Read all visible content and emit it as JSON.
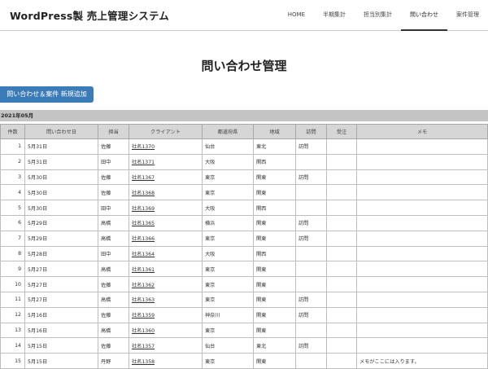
{
  "site_title": "WordPress製 売上管理システム",
  "nav": [
    {
      "label": "HOME"
    },
    {
      "label": "半期集計"
    },
    {
      "label": "担当別集計"
    },
    {
      "label": "問い合わせ"
    },
    {
      "label": "案件管理"
    }
  ],
  "page_title": "問い合わせ管理",
  "add_button_label": "問い合わせ＆案件 新規追加",
  "month_label": "2021年05月",
  "table": {
    "headers": [
      "件数",
      "問い合わせ日",
      "担当",
      "クライアント",
      "都道府県",
      "地域",
      "訪問",
      "受注",
      "メモ"
    ],
    "rows": [
      [
        "1",
        "5月31日",
        "佐藤",
        "社名1370",
        "仙台",
        "東北",
        "訪問",
        "",
        ""
      ],
      [
        "2",
        "5月31日",
        "田中",
        "社名1371",
        "大阪",
        "関西",
        "",
        "",
        ""
      ],
      [
        "3",
        "5月30日",
        "佐藤",
        "社名1367",
        "東京",
        "関東",
        "訪問",
        "",
        ""
      ],
      [
        "4",
        "5月30日",
        "佐藤",
        "社名1368",
        "東京",
        "関東",
        "",
        "",
        ""
      ],
      [
        "5",
        "5月30日",
        "田中",
        "社名1369",
        "大阪",
        "関西",
        "",
        "",
        ""
      ],
      [
        "6",
        "5月29日",
        "高橋",
        "社名1365",
        "横浜",
        "関東",
        "訪問",
        "",
        ""
      ],
      [
        "7",
        "5月29日",
        "高橋",
        "社名1366",
        "東京",
        "関東",
        "訪問",
        "",
        ""
      ],
      [
        "8",
        "5月28日",
        "田中",
        "社名1364",
        "大阪",
        "関西",
        "",
        "",
        ""
      ],
      [
        "9",
        "5月27日",
        "高橋",
        "社名1361",
        "東京",
        "関東",
        "",
        "",
        ""
      ],
      [
        "10",
        "5月27日",
        "佐藤",
        "社名1362",
        "東京",
        "関東",
        "",
        "",
        ""
      ],
      [
        "11",
        "5月27日",
        "高橋",
        "社名1363",
        "東京",
        "関東",
        "訪問",
        "",
        ""
      ],
      [
        "12",
        "5月16日",
        "佐藤",
        "社名1359",
        "神奈川",
        "関東",
        "訪問",
        "",
        ""
      ],
      [
        "13",
        "5月16日",
        "高橋",
        "社名1360",
        "東京",
        "関東",
        "",
        "",
        ""
      ],
      [
        "14",
        "5月15日",
        "佐藤",
        "社名1357",
        "仙台",
        "東北",
        "訪問",
        "",
        ""
      ],
      [
        "15",
        "5月15日",
        "丹野",
        "社名1358",
        "東京",
        "関東",
        "",
        "",
        "メモがここには入ります。"
      ]
    ]
  }
}
